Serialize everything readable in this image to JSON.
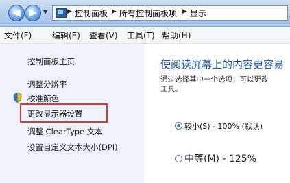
{
  "address_bar": {
    "breadcrumbs": [
      "控制面板",
      "所有控制面板项",
      "显示"
    ],
    "back_glyph": "◀",
    "forward_glyph": "▶",
    "dropdown_glyph": "▼",
    "separator_glyph": "▶"
  },
  "menu": [
    {
      "label": "文件(F)"
    },
    {
      "label": "编辑(E)"
    },
    {
      "label": "查看(V)"
    },
    {
      "label": "工具(T)"
    },
    {
      "label": "帮助(H)"
    }
  ],
  "sidebar": {
    "items": [
      {
        "label": "控制面板主页"
      },
      {
        "label": "调整分辨率"
      },
      {
        "label": "校准颜色"
      },
      {
        "label": "更改显示器设置",
        "highlighted": true
      },
      {
        "label": "调整 ClearType 文本"
      },
      {
        "label": "设置自定义文本大小(DPI)"
      }
    ],
    "highlight_color": "#e0353b"
  },
  "main": {
    "heading": "使阅读屏幕上的内容更容易",
    "description_line1": "通过选择其中一个选项，可以更改",
    "description_line2": "工具。",
    "options": [
      {
        "label": "较小(S) - 100% (默认)",
        "selected": true
      },
      {
        "label": "中等(M) - 125%",
        "selected": false
      }
    ]
  },
  "colors": {
    "heading": "#1e5aa8",
    "sidebar_bg": "#eef2f8",
    "address_bar_bg": "#b6d0ee"
  }
}
